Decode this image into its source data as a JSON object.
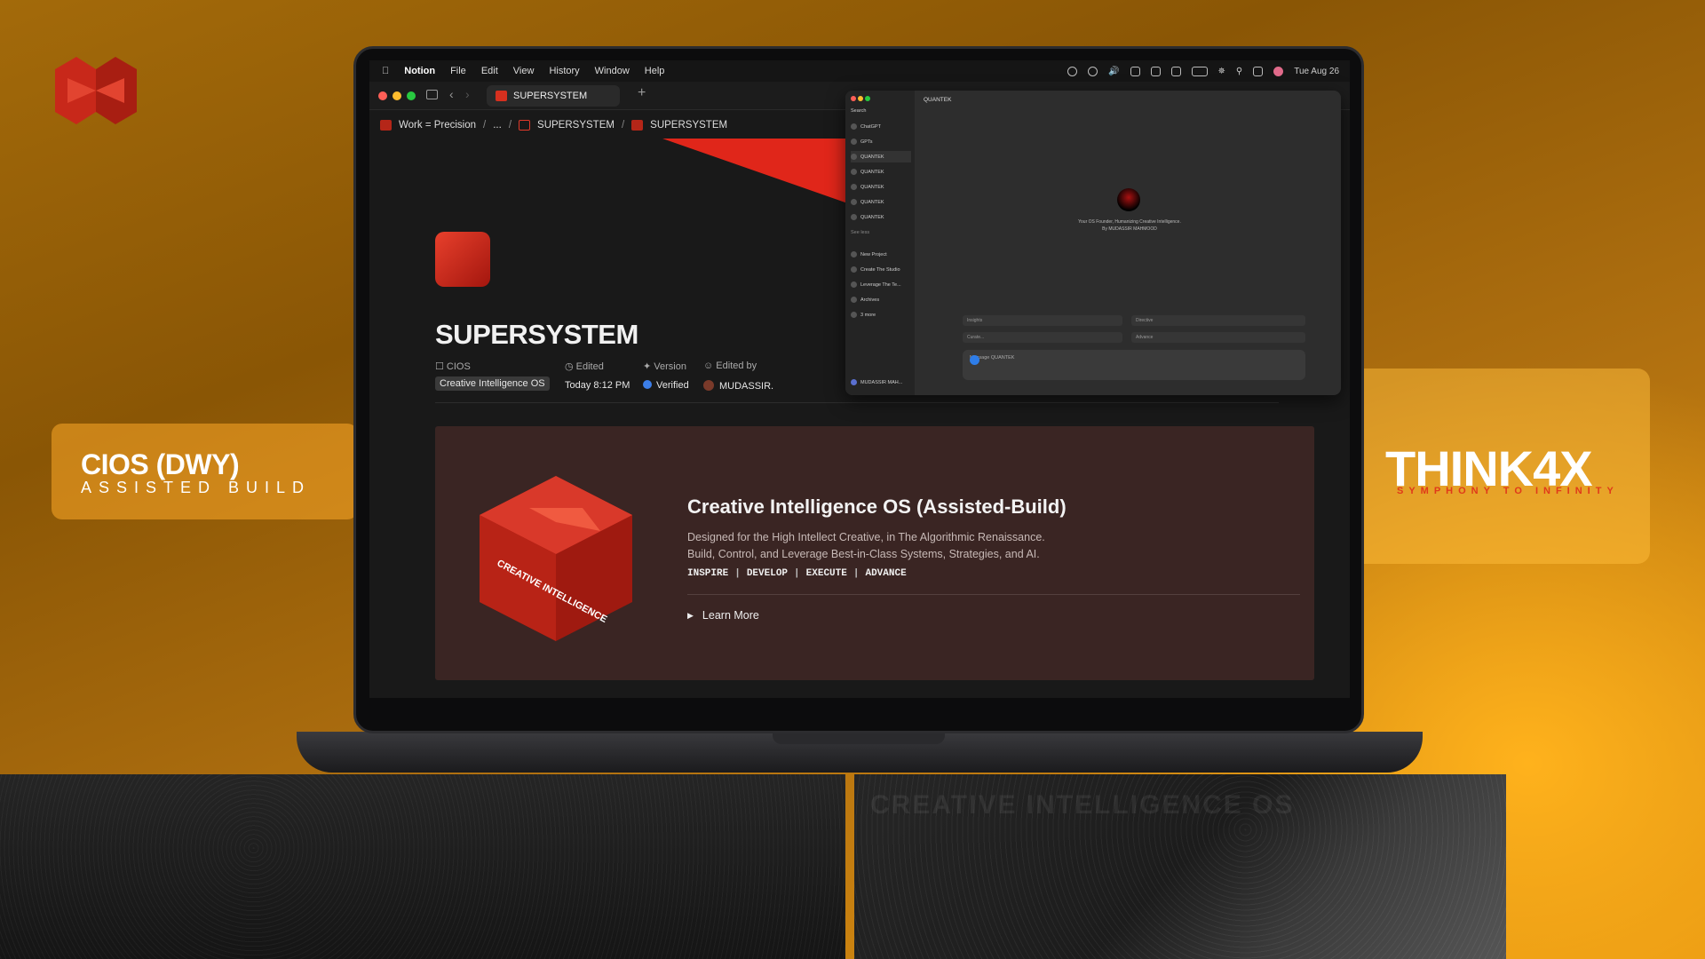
{
  "brand": {
    "logo_icon": "think4x-cube-logo-icon",
    "left_badge_title": "CIOS (DWY)",
    "left_badge_subtitle": "ASSISTED BUILD",
    "right_badge_title": "THINK4X",
    "right_badge_subtitle": "SYMPHONY TO INFINITY",
    "pedestal_text": "CREATIVE INTELLIGENCE OS",
    "colors": {
      "accent_red": "#d6301f",
      "orange_bg": "#e59510"
    }
  },
  "menubar": {
    "apple_icon": "apple-icon",
    "app": "Notion",
    "items": [
      "File",
      "Edit",
      "View",
      "History",
      "Window",
      "Help"
    ],
    "date": "Tue Aug 26"
  },
  "tabbar": {
    "tab_label": "SUPERSYSTEM",
    "new_tab": "+"
  },
  "breadcrumb": {
    "items": [
      "Work = Precision",
      "/",
      "...",
      "/",
      "SUPERSYSTEM",
      "/",
      "SUPERSYSTEM"
    ]
  },
  "page": {
    "title": "SUPERSYSTEM",
    "properties": {
      "cios_label": "CIOS",
      "cios_value": "Creative Intelligence OS",
      "edited_label": "Edited",
      "edited_value": "Today 8:12 PM",
      "version_label": "Version",
      "version_value": "Verified",
      "edited_by_label": "Edited by",
      "edited_by_value": "MUDASSIR."
    }
  },
  "callout": {
    "title": "Creative Intelligence OS (Assisted-Build)",
    "desc_line1": "Designed for the High Intellect Creative, in The Algorithmic Renaissance.",
    "desc_line2": "Build, Control, and Leverage Best-in-Class Systems, Strategies, and AI.",
    "tags": [
      "INSPIRE",
      "DEVELOP",
      "EXECUTE",
      "ADVANCE"
    ],
    "toggle_label": "Learn More",
    "cube_text": "CREATIVE INTELLIGENCE"
  },
  "chat_window": {
    "title": "QUANTEK",
    "search": "Search",
    "sidebar_items": [
      "ChatGPT",
      "GPTs",
      "QUANTEK",
      "QUANTEK",
      "QUANTEK",
      "QUANTEK",
      "QUANTEK"
    ],
    "see_less": "See less",
    "projects": [
      "New Project",
      "Create The Studio",
      "Leverage The Te...",
      "Archives",
      "3 more"
    ],
    "user": "MUDASSIR MAH...",
    "caption_line1": "Your OS Founder, Humanizing Creative Intelligence.",
    "caption_line2": "By MUDASSIR MAHMOOD",
    "fields": [
      "Insights",
      "Directive",
      "Curate...",
      "Advance"
    ],
    "input_placeholder": "Message QUANTEK"
  }
}
